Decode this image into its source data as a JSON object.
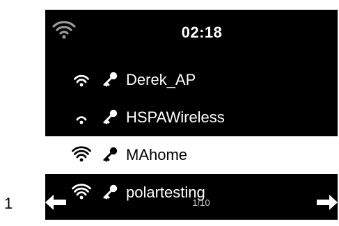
{
  "figure": {
    "label": "1"
  },
  "status_bar": {
    "time": "02:18",
    "signal_icon": "wifi-icon"
  },
  "networks": [
    {
      "ssid": "Derek_AP",
      "signal_icon": "wifi-icon",
      "signal_bars": 2,
      "secured": true,
      "secured_icon": "key-icon",
      "selected": false
    },
    {
      "ssid": "HSPAWireless",
      "signal_icon": "wifi-icon",
      "signal_bars": 1,
      "secured": true,
      "secured_icon": "key-icon",
      "selected": false
    },
    {
      "ssid": "MAhome",
      "signal_icon": "wifi-icon",
      "signal_bars": 3,
      "secured": true,
      "secured_icon": "key-icon",
      "selected": true
    },
    {
      "ssid": "polartesting",
      "signal_icon": "wifi-icon",
      "signal_bars": 3,
      "secured": true,
      "secured_icon": "key-icon",
      "selected": false
    }
  ],
  "footer": {
    "page": "1/10",
    "prev_icon": "arrow-left-icon",
    "next_icon": "arrow-right-icon"
  },
  "colors": {
    "screen_background": "#000000",
    "text": "#ffffff",
    "selected_background": "#ffffff",
    "selected_text": "#000000"
  }
}
